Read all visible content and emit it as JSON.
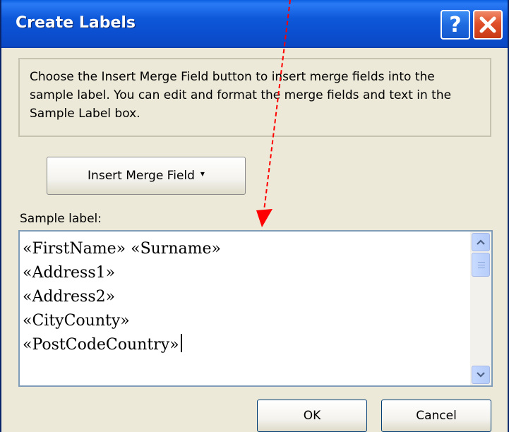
{
  "window": {
    "title": "Create Labels",
    "help_label": "?"
  },
  "info": {
    "text": "Choose the Insert Merge Field button to insert merge fields into the sample label.  You can edit and format the merge fields and text in the Sample Label box."
  },
  "merge_button": {
    "label": "Insert Merge Field",
    "caret": "▾"
  },
  "sample": {
    "caption": "Sample label:",
    "lines": [
      "«FirstName» «Surname»",
      "«Address1»",
      "«Address2»",
      "«CityCounty»",
      "«PostCodeCountry»"
    ]
  },
  "buttons": {
    "ok": "OK",
    "cancel": "Cancel"
  },
  "colors": {
    "titlebar": "#0b4fd0",
    "close": "#e0502a",
    "annotation_arrow": "#ff0000",
    "dialog_bg": "#ece9d8"
  },
  "icons": {
    "help": "question-mark-icon",
    "close": "close-x-icon",
    "scroll_up": "chevron-up-icon",
    "scroll_down": "chevron-down-icon",
    "annotation": "red-dashed-arrow"
  }
}
